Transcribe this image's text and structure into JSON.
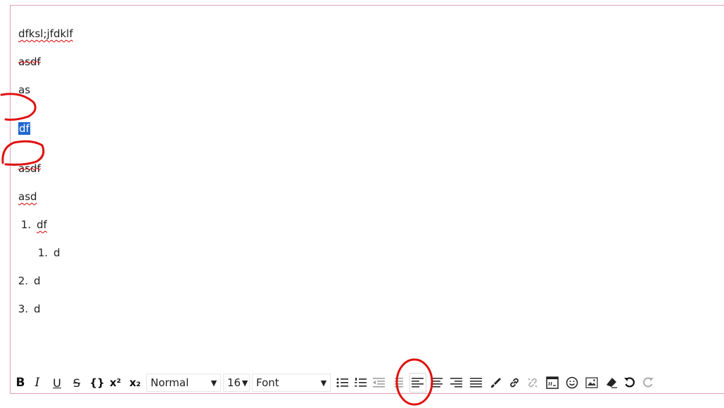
{
  "document": {
    "lines": [
      {
        "text": "dfksl;jfdklf"
      },
      {
        "text": "asdf"
      },
      {
        "text": "as"
      },
      {
        "text": "df"
      },
      {
        "text": "asdf"
      },
      {
        "text": "asd"
      }
    ],
    "list": [
      {
        "num": "1.",
        "text": "df"
      },
      {
        "num": "1.",
        "text": "d"
      },
      {
        "num": "2.",
        "text": "d"
      },
      {
        "num": "3.",
        "text": "d"
      }
    ]
  },
  "toolbar": {
    "bold": "B",
    "italic": "I",
    "underline": "U",
    "strike": "S",
    "code": "{}",
    "superscript": "x²",
    "subscript": "x₂",
    "block_format": "Normal",
    "font_size": "16",
    "font_family": "Font"
  },
  "colors": {
    "frame_border": "#e0a2b4",
    "spell_error": "#d60000",
    "selection": "#1e66d0",
    "annotation": "#e01010"
  }
}
